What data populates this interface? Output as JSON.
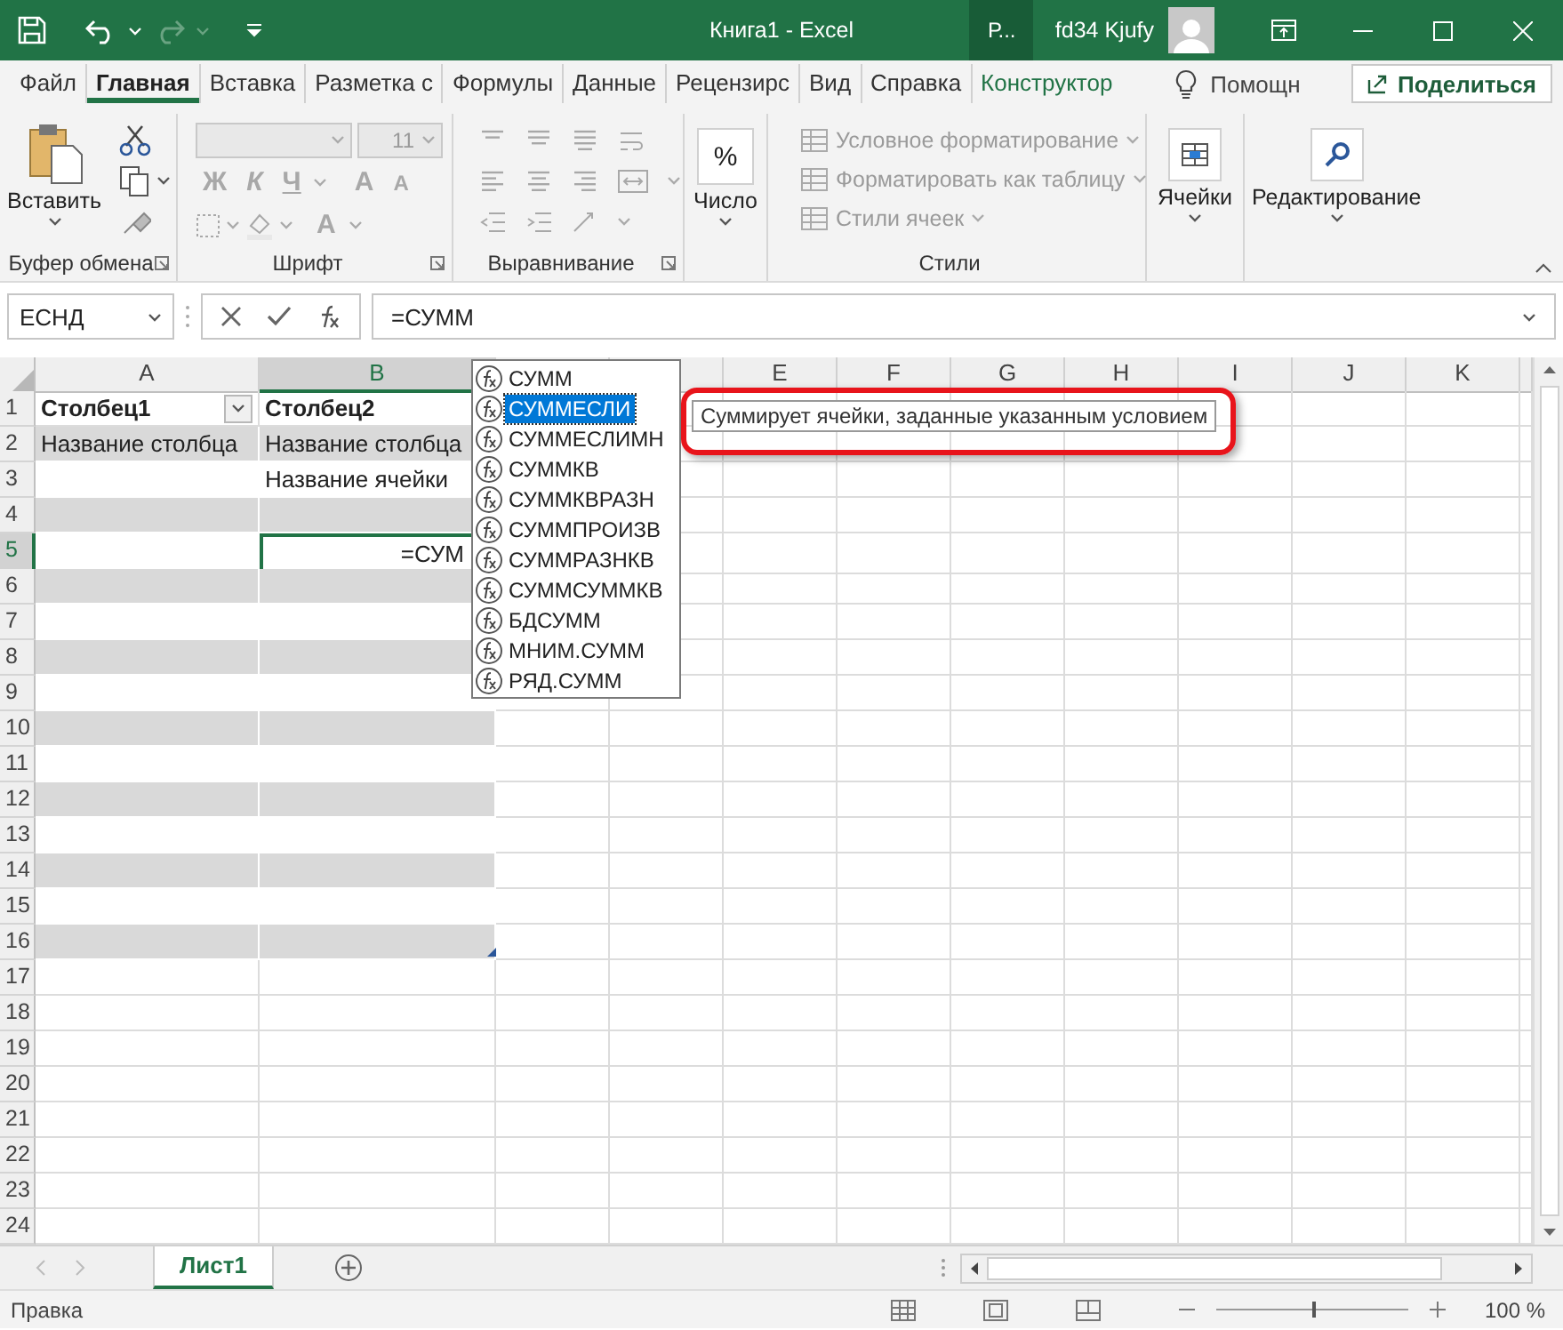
{
  "title_bar": {
    "title": "Книга1 - Excel",
    "search_label": "Р...",
    "user_name": "fd34 Kjufy"
  },
  "ribbon_tabs": [
    {
      "label": "Файл",
      "selected": false,
      "kind": "normal"
    },
    {
      "label": "Главная",
      "selected": true,
      "kind": "normal"
    },
    {
      "label": "Вставка",
      "selected": false,
      "kind": "normal"
    },
    {
      "label": "Разметка с",
      "selected": false,
      "kind": "normal"
    },
    {
      "label": "Формулы",
      "selected": false,
      "kind": "normal"
    },
    {
      "label": "Данные",
      "selected": false,
      "kind": "normal"
    },
    {
      "label": "Рецензирс",
      "selected": false,
      "kind": "normal"
    },
    {
      "label": "Вид",
      "selected": false,
      "kind": "normal"
    },
    {
      "label": "Справка",
      "selected": false,
      "kind": "normal"
    },
    {
      "label": "Конструктор",
      "selected": false,
      "kind": "contextual"
    }
  ],
  "tell_me": {
    "label": "Помощн"
  },
  "share_button": {
    "label": "Поделиться"
  },
  "ribbon": {
    "groups": [
      {
        "kind": "clipboard",
        "label": "Буфер обмена",
        "paste_label": "Вставить",
        "launcher": true
      },
      {
        "kind": "font",
        "label": "Шрифт",
        "font_size": "11",
        "bold": "Ж",
        "italic": "К",
        "underline": "Ч",
        "grow": "A",
        "shrink": "A",
        "font_color": "A",
        "disabled": true,
        "launcher": true
      },
      {
        "kind": "alignment",
        "label": "Выравнивание",
        "disabled": true,
        "launcher": true
      },
      {
        "kind": "number",
        "label": "Число",
        "glyph": "%"
      },
      {
        "kind": "styles",
        "label": "Стили",
        "commands": [
          {
            "label": "Условное форматирование",
            "disabled": true
          },
          {
            "label": "Форматировать как таблицу",
            "disabled": true
          },
          {
            "label": "Стили ячеек",
            "disabled": true
          }
        ]
      },
      {
        "kind": "cells",
        "label": "Ячейки"
      },
      {
        "kind": "editing",
        "label": "Редактирование"
      }
    ]
  },
  "formula_bar": {
    "name_box": "ЕСНД",
    "formula": "=СУММ"
  },
  "sheet": {
    "columns": [
      {
        "label": "A",
        "selected": false
      },
      {
        "label": "B",
        "selected": true
      },
      {
        "selected": false
      },
      {
        "selected": false
      },
      {
        "label": "E",
        "selected": false
      },
      {
        "label": "F",
        "selected": false
      },
      {
        "label": "G",
        "selected": false
      },
      {
        "label": "H",
        "selected": false
      },
      {
        "label": "I",
        "selected": false
      },
      {
        "label": "J",
        "selected": false
      },
      {
        "label": "K",
        "selected": false
      }
    ],
    "rows": [
      {
        "label": "1",
        "selected": false,
        "kind": "table-header",
        "cells": [
          {
            "text": "Столбец1",
            "filter_button": true
          },
          {
            "text": "Столбец2",
            "filter_button": false
          }
        ]
      },
      {
        "label": "2",
        "selected": false,
        "kind": "table-band",
        "cells": [
          {
            "text": "Название столбца"
          },
          {
            "text": "Название столбца"
          }
        ]
      },
      {
        "label": "3",
        "selected": false,
        "kind": "table-plain",
        "cells": [
          {},
          {
            "text": "Название ячейки"
          }
        ]
      },
      {
        "label": "4",
        "selected": false,
        "kind": "table-band",
        "cells": [
          {},
          {}
        ]
      },
      {
        "label": "5",
        "selected": true,
        "kind": "table-plain",
        "cells": [
          {},
          {
            "text": "=СУМ",
            "active": true
          }
        ]
      },
      {
        "label": "6",
        "selected": false,
        "kind": "table-band",
        "cells": [
          {},
          {}
        ]
      },
      {
        "label": "7",
        "selected": false,
        "kind": "table-plain",
        "cells": [
          {},
          {}
        ]
      },
      {
        "label": "8",
        "selected": false,
        "kind": "table-band",
        "cells": [
          {},
          {}
        ]
      },
      {
        "label": "9",
        "selected": false,
        "kind": "table-plain",
        "cells": [
          {},
          {}
        ]
      },
      {
        "label": "10",
        "selected": false,
        "kind": "table-band",
        "cells": [
          {},
          {}
        ]
      },
      {
        "label": "11",
        "selected": false,
        "kind": "table-plain",
        "cells": [
          {},
          {}
        ]
      },
      {
        "label": "12",
        "selected": false,
        "kind": "table-band",
        "cells": [
          {},
          {}
        ]
      },
      {
        "label": "13",
        "selected": false,
        "kind": "table-plain",
        "cells": [
          {},
          {}
        ]
      },
      {
        "label": "14",
        "selected": false,
        "kind": "table-band",
        "cells": [
          {},
          {}
        ]
      },
      {
        "label": "15",
        "selected": false,
        "kind": "table-plain",
        "cells": [
          {},
          {}
        ]
      },
      {
        "label": "16",
        "selected": false,
        "kind": "table-band",
        "cells": [
          {},
          {}
        ]
      },
      {
        "label": "17",
        "selected": false,
        "kind": "sheet"
      },
      {
        "label": "18",
        "selected": false,
        "kind": "sheet"
      },
      {
        "label": "19",
        "selected": false,
        "kind": "sheet"
      },
      {
        "label": "20",
        "selected": false,
        "kind": "sheet"
      },
      {
        "label": "21",
        "selected": false,
        "kind": "sheet"
      },
      {
        "label": "22",
        "selected": false,
        "kind": "sheet"
      },
      {
        "label": "23",
        "selected": false,
        "kind": "sheet"
      },
      {
        "label": "24",
        "selected": false,
        "kind": "sheet"
      }
    ]
  },
  "autocomplete": {
    "items": [
      {
        "label": "СУММ",
        "selected": false
      },
      {
        "label": "СУММЕСЛИ",
        "selected": true
      },
      {
        "label": "СУММЕСЛИМН",
        "selected": false
      },
      {
        "label": "СУММКВ",
        "selected": false
      },
      {
        "label": "СУММКВРАЗН",
        "selected": false
      },
      {
        "label": "СУММПРОИЗВ",
        "selected": false
      },
      {
        "label": "СУММРАЗНКВ",
        "selected": false
      },
      {
        "label": "СУММСУММКВ",
        "selected": false
      },
      {
        "label": "БДСУММ",
        "selected": false
      },
      {
        "label": "МНИМ.СУММ",
        "selected": false
      },
      {
        "label": "РЯД.СУММ",
        "selected": false
      }
    ]
  },
  "tooltip": {
    "text": "Суммирует ячейки, заданные указанным условием",
    "highlighted": true
  },
  "sheet_tabs": [
    {
      "label": "Лист1",
      "selected": true
    }
  ],
  "status_bar": {
    "mode": "Правка",
    "zoom": "100 %",
    "zoom_slider": {
      "level": 0.5
    }
  }
}
